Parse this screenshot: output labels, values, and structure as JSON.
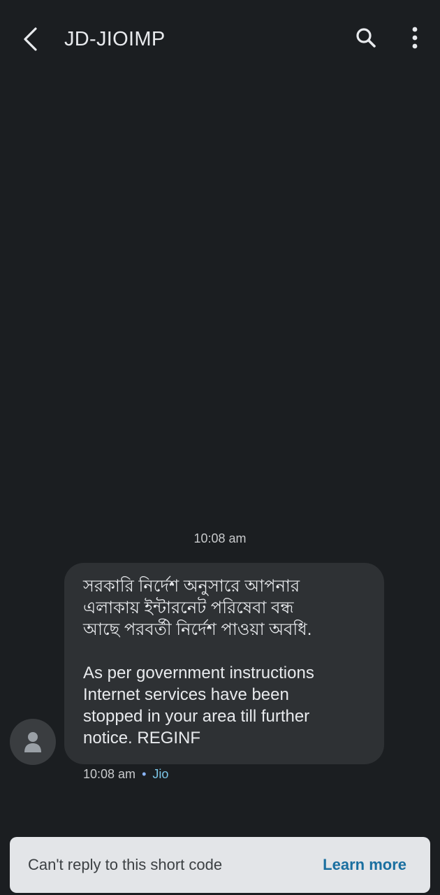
{
  "header": {
    "title": "JD-JIOIMP",
    "back_icon": "chevron-left-icon",
    "search_icon": "search-icon",
    "menu_icon": "more-vert-icon"
  },
  "conversation": {
    "date_divider": "10:08 am",
    "message": {
      "bengali_line1": "সরকারি নির্দেশ অনুসারে আপনার",
      "bengali_line2": "এলাকায় ইন্টারনেট পরিষেবা বন্ধ",
      "bengali_line3": "আছে পরবর্তী নির্দেশ পাওয়া অবধি.",
      "english_line1": "As per government instructions",
      "english_line2": "Internet services have been",
      "english_line3": "stopped in your area till further",
      "english_line4": "notice. REGINF",
      "time": "10:08 am",
      "separator": "•",
      "carrier": "Jio"
    },
    "avatar_icon": "person-icon"
  },
  "footer": {
    "notice": "Can't reply to this short code",
    "learn_more": "Learn more"
  },
  "colors": {
    "background": "#1b1e21",
    "bubble": "#2e3134",
    "footer": "#e3e5e8",
    "link": "#1a6fa0"
  }
}
